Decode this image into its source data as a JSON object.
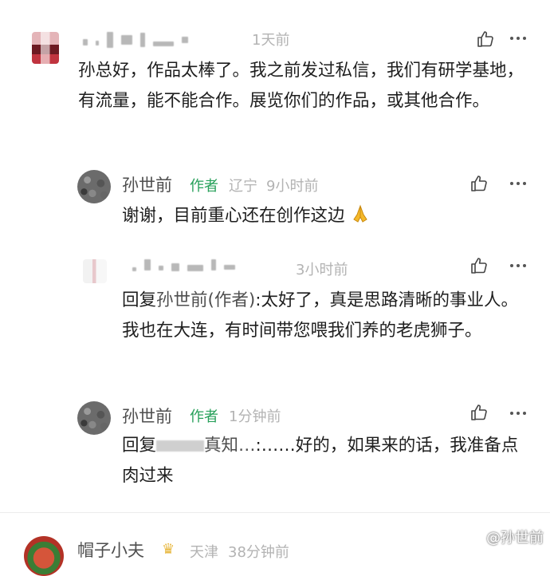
{
  "comments": [
    {
      "id": "c1",
      "time": "1天前",
      "text": "孙总好，作品太棒了。我之前发过私信，我们有研学基地，有流量，能不能合作。展览你们的作品，或其他合作。"
    },
    {
      "id": "c2",
      "name": "孙世前",
      "tag": "作者",
      "region": "辽宁",
      "time": "9小时前",
      "text": "谢谢，目前重心还在创作这边",
      "emoji": "folded-hands"
    },
    {
      "id": "c3",
      "time": "3小时前",
      "reply_prefix": "回复",
      "reply_target": "孙世前(作者)",
      "text": ":太好了，真是思路清晰的事业人。我也在大连，有时间带您喂我们养的老虎狮子。"
    },
    {
      "id": "c4",
      "name": "孙世前",
      "tag": "作者",
      "time": "1分钟前",
      "reply_prefix": "回复",
      "reply_fragment": "真知…",
      "text": ":……好的，如果来的话，我准备点肉过来"
    },
    {
      "id": "c5",
      "name": "帽子小夫",
      "region": "天津",
      "time": "38分钟前"
    }
  ],
  "watermark": "@孙世前",
  "colors": {
    "author_tag": "#27a05a",
    "meta": "#b3b3b3",
    "name": "#4e4e4e",
    "text": "#1e1e1e"
  },
  "icons": [
    "thumbs-up-icon",
    "more-icon",
    "weibo-icon"
  ]
}
